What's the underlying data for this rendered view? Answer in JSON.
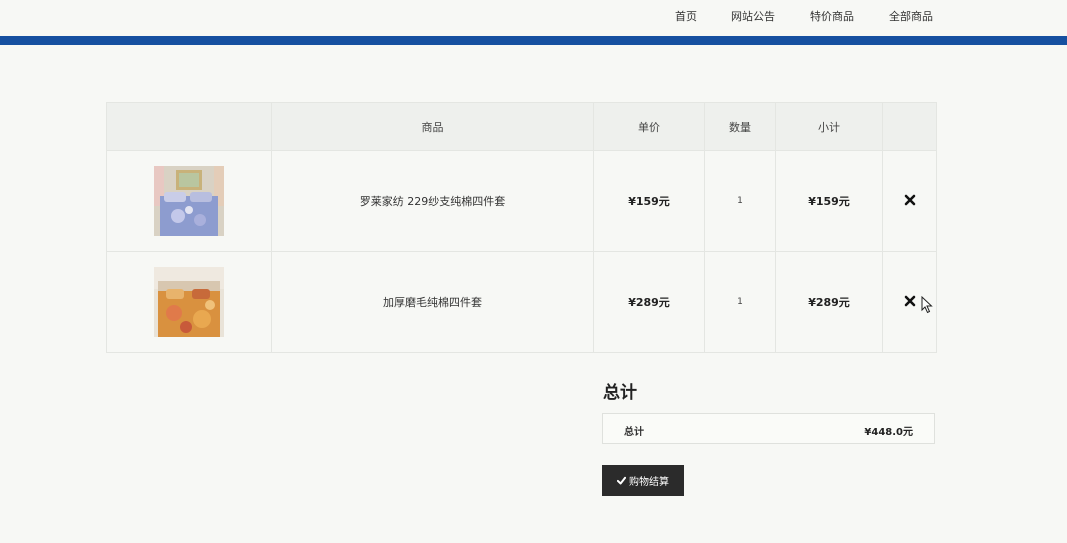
{
  "nav": {
    "items": [
      "首页",
      "网站公告",
      "特价商品",
      "全部商品"
    ]
  },
  "cart": {
    "headers": [
      "",
      "商品",
      "单价",
      "数量",
      "小计",
      ""
    ],
    "rows": [
      {
        "name": "罗莱家纺 229纱支纯棉四件套",
        "price": "¥159元",
        "qty": "1",
        "subtotal": "¥159元",
        "image": "bedding-blue-floral"
      },
      {
        "name": "加厚磨毛纯棉四件套",
        "price": "¥289元",
        "qty": "1",
        "subtotal": "¥289元",
        "image": "bedding-orange-floral"
      }
    ]
  },
  "totals": {
    "title": "总计",
    "label": "总计",
    "value": "¥448.0元"
  },
  "checkout": {
    "label": "购物结算",
    "icon": "check-icon"
  },
  "colors": {
    "accent_bar": "#1650a0",
    "button_bg": "#2b2b2b"
  }
}
